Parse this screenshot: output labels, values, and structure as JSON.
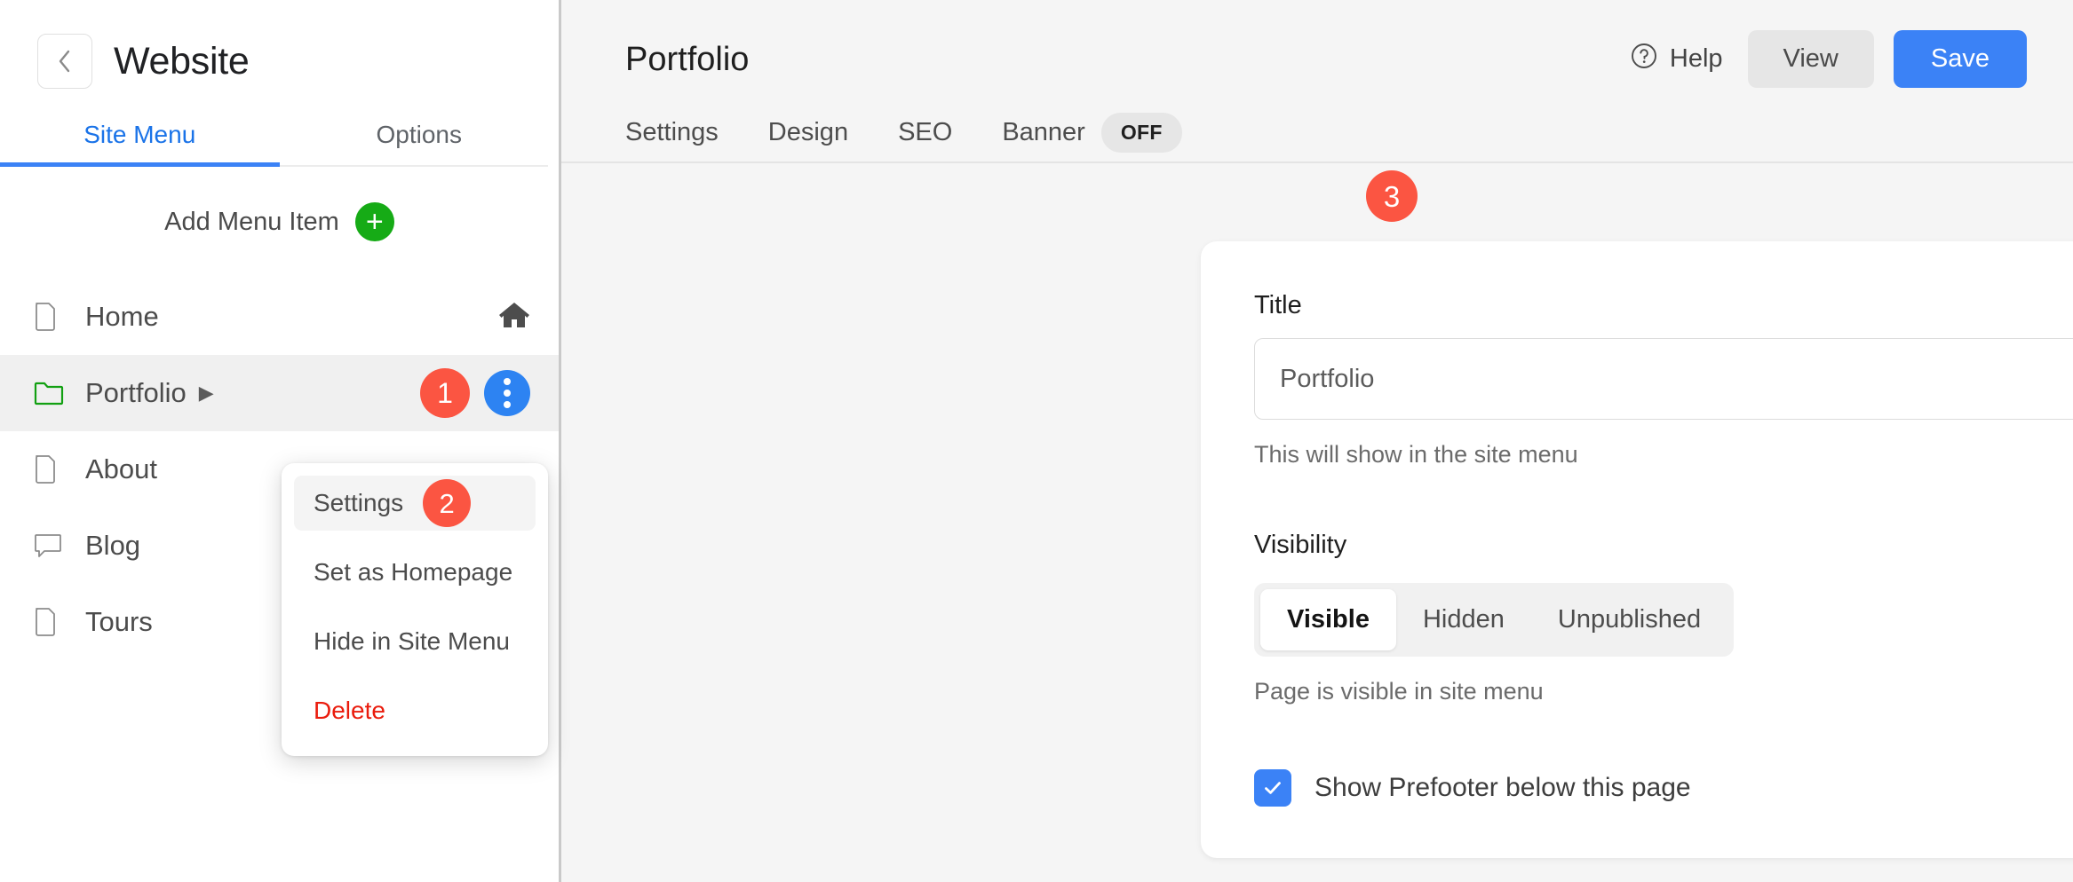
{
  "sidebar": {
    "back_icon": "chevron-left-icon",
    "title": "Website",
    "tabs": [
      {
        "label": "Site Menu",
        "active": true
      },
      {
        "label": "Options",
        "active": false
      }
    ],
    "add_menu_item": {
      "label": "Add Menu Item",
      "icon": "plus-icon"
    },
    "items": [
      {
        "label": "Home",
        "icon": "page-icon",
        "trailing_icon": "home-icon",
        "selected": false
      },
      {
        "label": "Portfolio",
        "icon": "folder-icon",
        "caret": "▶",
        "selected": true,
        "badge": "1",
        "dots_icon": "three-dots-vertical-icon"
      },
      {
        "label": "About",
        "icon": "page-icon",
        "selected": false
      },
      {
        "label": "Blog",
        "icon": "speech-bubble-icon",
        "selected": false
      },
      {
        "label": "Tours",
        "icon": "page-icon",
        "selected": false
      }
    ]
  },
  "context_menu": {
    "items": [
      {
        "label": "Settings",
        "highlighted": true,
        "badge": "2"
      },
      {
        "label": "Set as Homepage",
        "highlighted": false
      },
      {
        "label": "Hide in Site Menu",
        "highlighted": false
      },
      {
        "label": "Delete",
        "highlighted": false,
        "danger": true
      }
    ]
  },
  "main": {
    "title": "Portfolio",
    "help": {
      "label": "Help",
      "icon": "question-circle-icon"
    },
    "view_button": "View",
    "save_button": "Save",
    "tabs": [
      {
        "label": "Settings"
      },
      {
        "label": "Design"
      },
      {
        "label": "SEO"
      },
      {
        "label": "Banner",
        "toggle": "OFF"
      }
    ],
    "badge": "3",
    "form": {
      "title_label": "Title",
      "title_value": "Portfolio",
      "title_placeholder": "Portfolio",
      "title_helper": "This will show in the site menu",
      "visibility_label": "Visibility",
      "visibility_options": [
        {
          "label": "Visible",
          "active": true
        },
        {
          "label": "Hidden",
          "active": false
        },
        {
          "label": "Unpublished",
          "active": false
        }
      ],
      "visibility_helper": "Page is visible in site menu",
      "prefooter_label": "Show Prefooter below this page",
      "prefooter_checked": true
    }
  },
  "colors": {
    "accent_blue": "#3b82f6",
    "tab_blue": "#1a73e8",
    "badge_red": "#fb5542",
    "danger_red": "#ea1c0d",
    "green": "#16ab16"
  }
}
